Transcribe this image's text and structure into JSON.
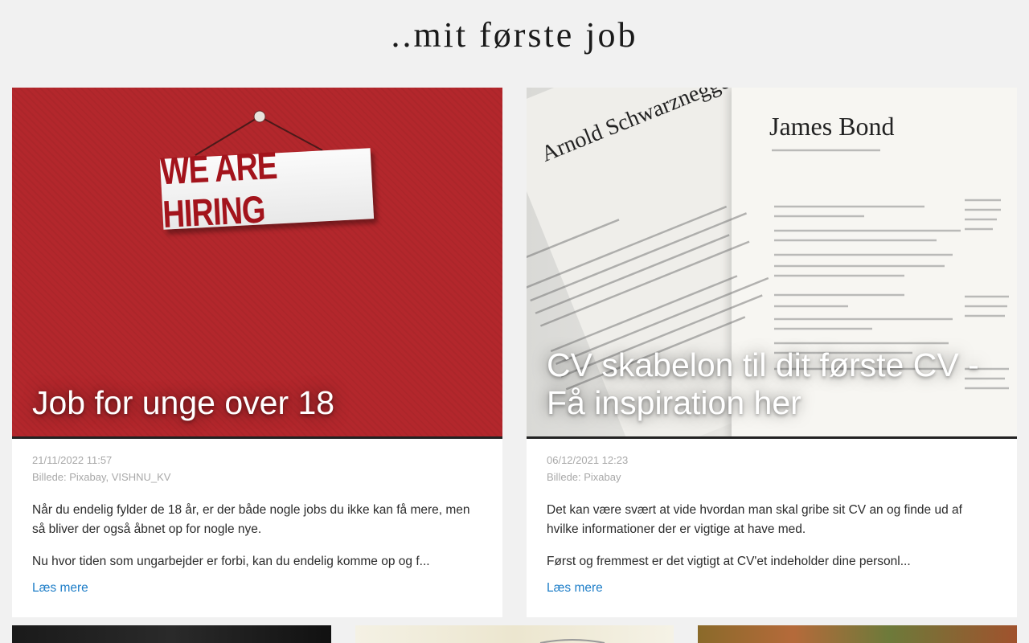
{
  "site": {
    "title": "..mit første job"
  },
  "posts": [
    {
      "title": "Job for unge over 18",
      "date": "21/11/2022 11:57",
      "credit": "Billede: Pixabay, VISHNU_KV",
      "paragraphs": [
        "Når du endelig fylder de 18 år, er der både nogle jobs du ikke kan få mere, men så bliver der også åbnet op for nogle nye.",
        "Nu hvor tiden som ungarbejder er forbi, kan du endelig komme op og f..."
      ],
      "read_more": "Læs mere",
      "image_text": "WE ARE HIRING"
    },
    {
      "title": "CV skabelon til dit første CV - Få inspiration her",
      "date": "06/12/2021 12:23",
      "credit": "Billede: Pixabay",
      "paragraphs": [
        "Det kan være svært at vide hvordan man skal gribe sit CV an og finde ud af hvilke informationer der er vigtige at have med.",
        "Først og fremmest er det vigtigt at CV'et indeholder dine personl..."
      ],
      "read_more": "Læs mere",
      "image_names": [
        "Arnold Schwarznegger",
        "James Bond"
      ]
    }
  ],
  "colors": {
    "background": "#f1f1f1",
    "link": "#1e7ec8",
    "meta": "#a8a8a8",
    "hiring_red": "#b3272c"
  }
}
